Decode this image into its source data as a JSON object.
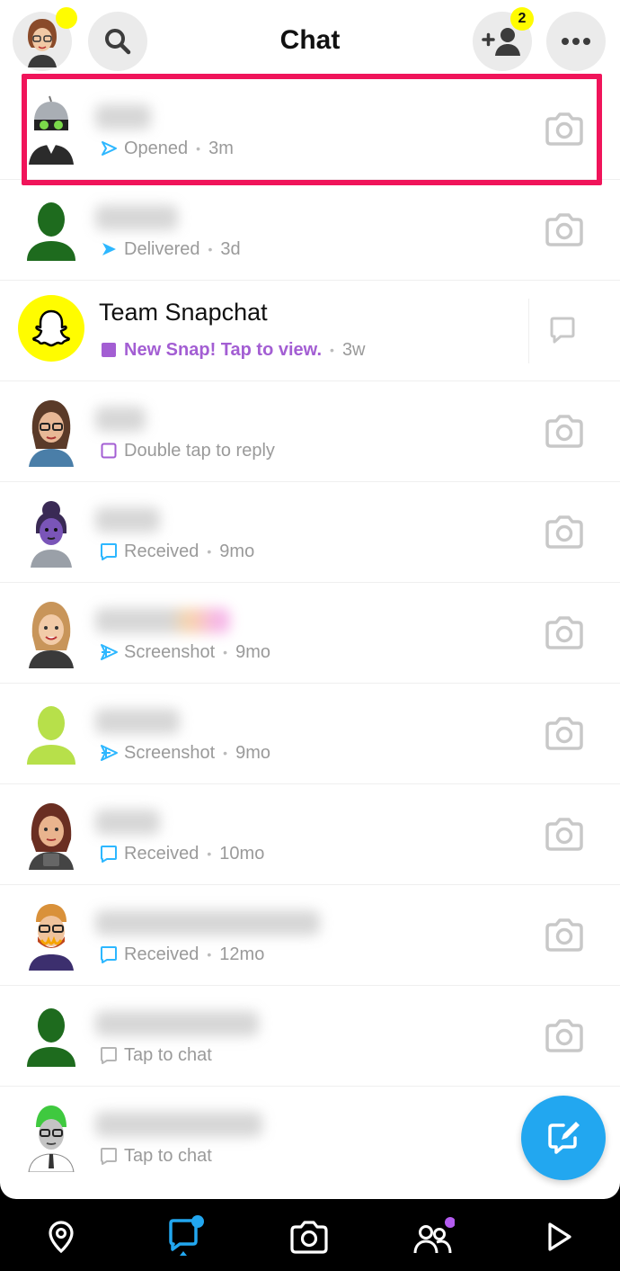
{
  "header": {
    "title": "Chat",
    "friend_requests_badge": "2",
    "icons": [
      "profile-avatar",
      "search-icon",
      "add-friend-icon",
      "more-icon"
    ]
  },
  "chats": [
    {
      "name_hidden": true,
      "status": "Opened",
      "time": "3m",
      "status_type": "sent-opened",
      "status_color": "#2db7ff",
      "avatar": "bitmoji-helmet"
    },
    {
      "name_hidden": true,
      "status": "Delivered",
      "time": "3d",
      "status_type": "sent-delivered",
      "status_color": "#2db7ff",
      "avatar": "silhouette-green"
    },
    {
      "name": "Team Snapchat",
      "status": "New Snap! Tap to view.",
      "time": "3w",
      "status_type": "new-snap",
      "status_color": "#a35ed3",
      "avatar": "snapchat-ghost"
    },
    {
      "name_hidden": true,
      "status": "Double tap to reply",
      "time": "",
      "status_type": "received-snap",
      "status_color": "#a35ed3",
      "avatar": "bitmoji-woman-glasses"
    },
    {
      "name_hidden": true,
      "status": "Received",
      "time": "9mo",
      "status_type": "received-chat",
      "status_color": "#2db7ff",
      "avatar": "bitmoji-purple"
    },
    {
      "name_hidden": true,
      "status": "Screenshot",
      "time": "9mo",
      "status_type": "screenshot",
      "status_color": "#2db7ff",
      "avatar": "bitmoji-blonde"
    },
    {
      "name_hidden": true,
      "status": "Screenshot",
      "time": "9mo",
      "status_type": "screenshot",
      "status_color": "#2db7ff",
      "avatar": "silhouette-lime"
    },
    {
      "name_hidden": true,
      "status": "Received",
      "time": "10mo",
      "status_type": "received-chat",
      "status_color": "#2db7ff",
      "avatar": "bitmoji-brunette"
    },
    {
      "name_hidden": true,
      "status": "Received",
      "time": "12mo",
      "status_type": "received-chat",
      "status_color": "#2db7ff",
      "avatar": "bitmoji-bearded"
    },
    {
      "name_hidden": true,
      "status": "Tap to chat",
      "time": "",
      "status_type": "tap-chat",
      "status_color": "#9a9a9a",
      "avatar": "silhouette-green"
    },
    {
      "name_hidden": true,
      "status": "Tap to chat",
      "time": "",
      "status_type": "tap-chat",
      "status_color": "#9a9a9a",
      "avatar": "bitmoji-green-hair"
    }
  ],
  "nav": {
    "items": [
      "map-icon",
      "chat-icon",
      "camera-icon",
      "friends-icon",
      "stories-icon"
    ],
    "active": "chat-icon"
  },
  "colors": {
    "highlight": "#f0145a",
    "accent_blue": "#22a7f0",
    "snap_purple": "#a35ed3",
    "snap_yellow": "#fffc00"
  }
}
